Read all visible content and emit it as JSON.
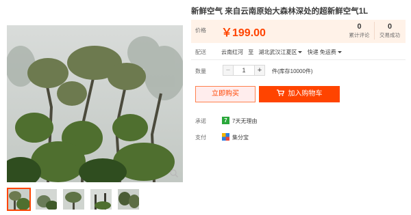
{
  "product": {
    "title": "新鲜空气 来自云南原始大森林深处的超新鲜空气1L"
  },
  "price": {
    "label": "价格",
    "value": "￥199.00",
    "stats": [
      {
        "num": "0",
        "label": "累计评论"
      },
      {
        "num": "0",
        "label": "交易成功"
      }
    ]
  },
  "shipping": {
    "label": "配送",
    "from": "云南红河",
    "to_word": "至",
    "destination": "湖北武汉江夏区",
    "method": "快递 免运费"
  },
  "quantity": {
    "label": "数量",
    "minus": "−",
    "value": "1",
    "plus": "+",
    "stock": "件(库存10000件)"
  },
  "actions": {
    "buy_now": "立即购买",
    "add_to_cart": "加入购物车"
  },
  "promise": {
    "label": "承诺",
    "icon_text": "7",
    "text": "7天无理由"
  },
  "payment": {
    "label": "支付",
    "text": "集分宝"
  },
  "gallery": {
    "thumbnail_count": 5,
    "selected_index": 0
  },
  "colors": {
    "accent": "#ff4400",
    "price_bg": "#fff2e8",
    "promise_green": "#2aa73a"
  },
  "icons": {
    "zoom": "magnifier-icon",
    "cart": "cart-icon",
    "promise": "seven-day-return-icon",
    "payment": "jifenbao-icon"
  }
}
